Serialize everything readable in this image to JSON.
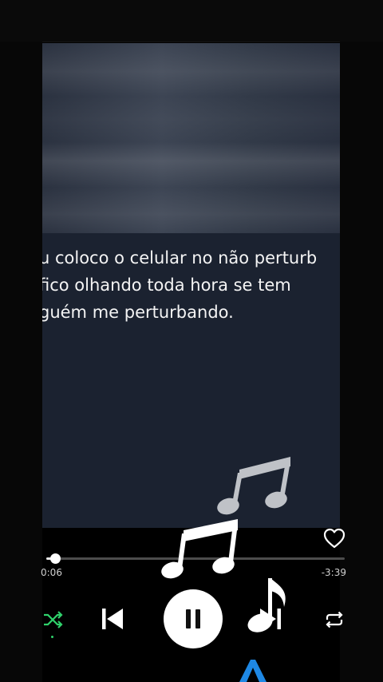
{
  "lyrics": {
    "lines": [
      "u coloco o celular no não perturb",
      "fico olhando toda hora se tem",
      "guém me perturbando."
    ]
  },
  "player": {
    "elapsed": "0:06",
    "remaining": "-3:39",
    "progress_fraction": 0.03,
    "liked": false,
    "playing": true,
    "shuffle_on": true
  },
  "icons": {
    "heart": "heart-outline-icon",
    "shuffle": "shuffle-icon",
    "previous": "skip-previous-icon",
    "play_pause": "pause-icon",
    "next": "skip-next-icon",
    "repeat": "repeat-icon",
    "overlay": "music-note-icon",
    "chevron": "chevron-up-icon"
  },
  "colors": {
    "background": "#000000",
    "card_background": "#1b2230",
    "text": "#f4f4f4",
    "shuffle_active": "#2fd16b",
    "chevron_accent": "#1e88e5"
  }
}
